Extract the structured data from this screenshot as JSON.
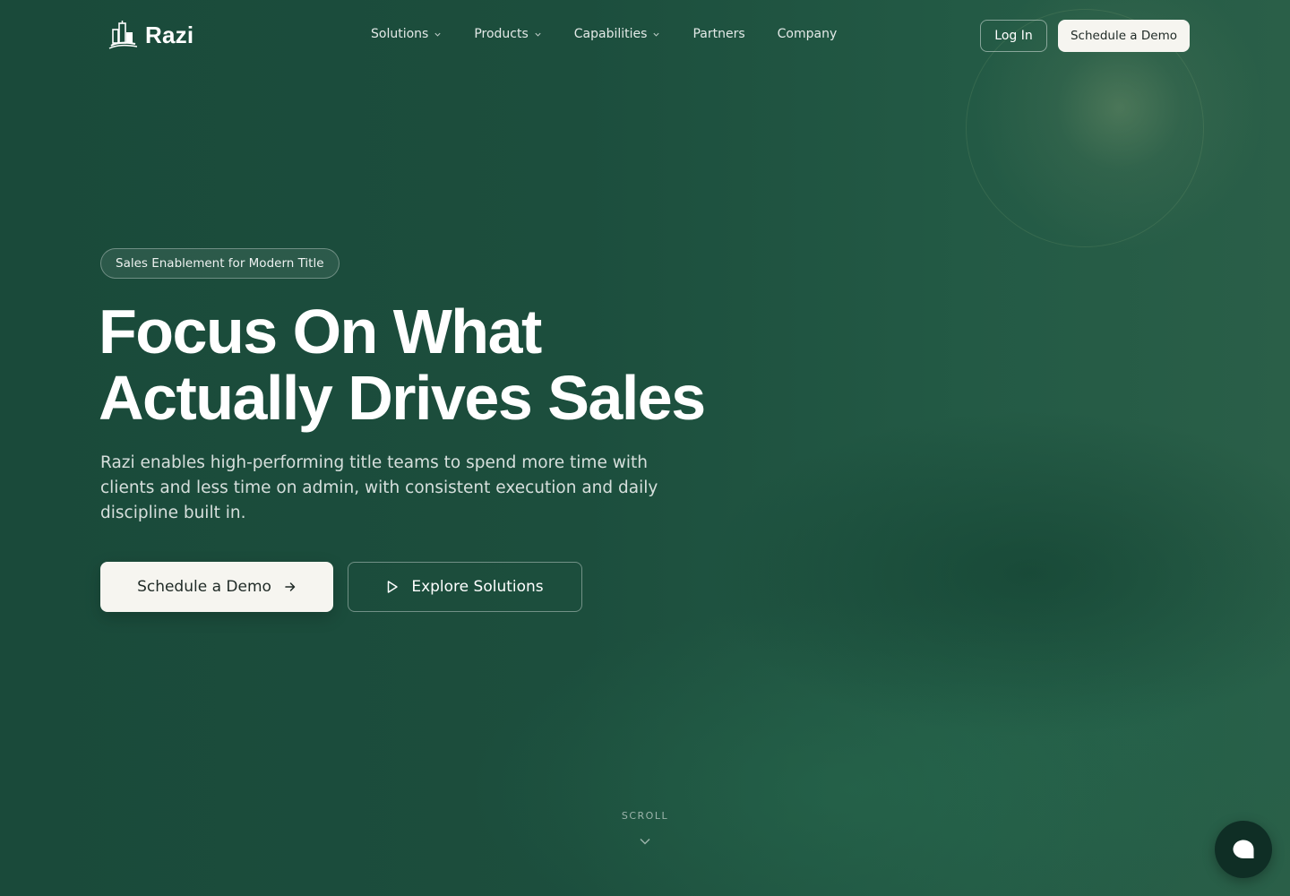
{
  "brand": {
    "name": "Razi",
    "logo_icon": "buildings-logo-icon"
  },
  "nav": {
    "items": [
      {
        "label": "Solutions",
        "has_dropdown": true
      },
      {
        "label": "Products",
        "has_dropdown": true
      },
      {
        "label": "Capabilities",
        "has_dropdown": true
      },
      {
        "label": "Partners",
        "has_dropdown": false
      },
      {
        "label": "Company",
        "has_dropdown": false
      }
    ],
    "login_label": "Log In",
    "demo_label": "Schedule a Demo"
  },
  "hero": {
    "badge": "Sales Enablement for Modern Title",
    "headline_line1": "Focus On What",
    "headline_line2": "Actually Drives Sales",
    "subtext": "Razi enables high-performing title teams to spend more time with clients and less time on admin, with consistent execution and daily discipline built in.",
    "cta_primary": "Schedule a Demo",
    "cta_secondary": "Explore Solutions"
  },
  "scroll": {
    "label": "SCROLL"
  },
  "chat": {
    "icon": "chat-bubble-icon"
  },
  "colors": {
    "background": "#1b4d3c",
    "button_light": "#f6f5f0",
    "button_text_dark": "#1f2a26",
    "chat_button": "#0f2e25"
  }
}
